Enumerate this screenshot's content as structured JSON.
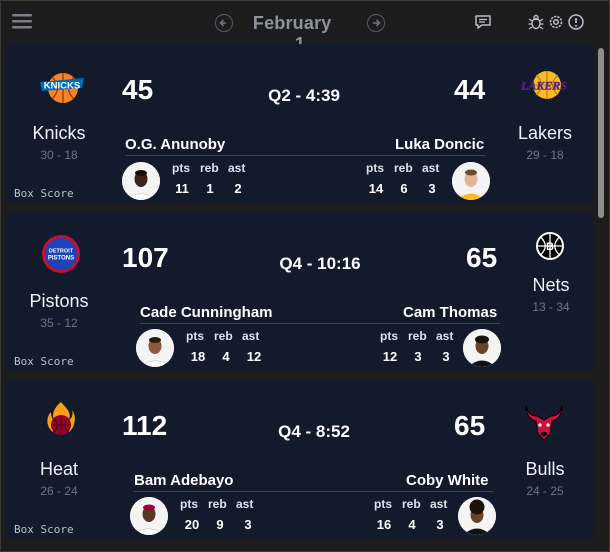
{
  "header": {
    "month": "February",
    "day": "1",
    "prev_label": "‹",
    "next_label": "›"
  },
  "games": [
    {
      "home": {
        "name": "Knicks",
        "record": "30 - 18",
        "score": "45",
        "color": "#f58426"
      },
      "away": {
        "name": "Lakers",
        "record": "29 - 18",
        "score": "44",
        "color": "#552583"
      },
      "status": "Q2 - 4:39",
      "box_score_label": "Box Score",
      "leaders": [
        {
          "name": "O.G. Anunoby",
          "pts": "11",
          "reb": "1",
          "ast": "2"
        },
        {
          "name": "Luka Doncic",
          "pts": "14",
          "reb": "6",
          "ast": "3"
        }
      ]
    },
    {
      "home": {
        "name": "Pistons",
        "record": "35 - 12",
        "score": "107",
        "color": "#1d42ba"
      },
      "away": {
        "name": "Nets",
        "record": "13 - 34",
        "score": "65",
        "color": "#000000"
      },
      "status": "Q4 - 10:16",
      "box_score_label": "Box Score",
      "leaders": [
        {
          "name": "Cade Cunningham",
          "pts": "18",
          "reb": "4",
          "ast": "12"
        },
        {
          "name": "Cam Thomas",
          "pts": "12",
          "reb": "3",
          "ast": "3"
        }
      ]
    },
    {
      "home": {
        "name": "Heat",
        "record": "26 - 24",
        "score": "112",
        "color": "#98002e"
      },
      "away": {
        "name": "Bulls",
        "record": "24 - 25",
        "score": "65",
        "color": "#ce1141"
      },
      "status": "Q4 - 8:52",
      "box_score_label": "Box Score",
      "leaders": [
        {
          "name": "Bam Adebayo",
          "pts": "20",
          "reb": "9",
          "ast": "3"
        },
        {
          "name": "Coby White",
          "pts": "16",
          "reb": "4",
          "ast": "3"
        }
      ]
    }
  ],
  "stat_labels": {
    "pts": "pts",
    "reb": "reb",
    "ast": "ast"
  },
  "knicks_wordmark": "KNICKS",
  "lakers_wordmark": "LAKERS",
  "pistons_wordmark_1": "DETROIT",
  "pistons_wordmark_2": "PISTONS"
}
